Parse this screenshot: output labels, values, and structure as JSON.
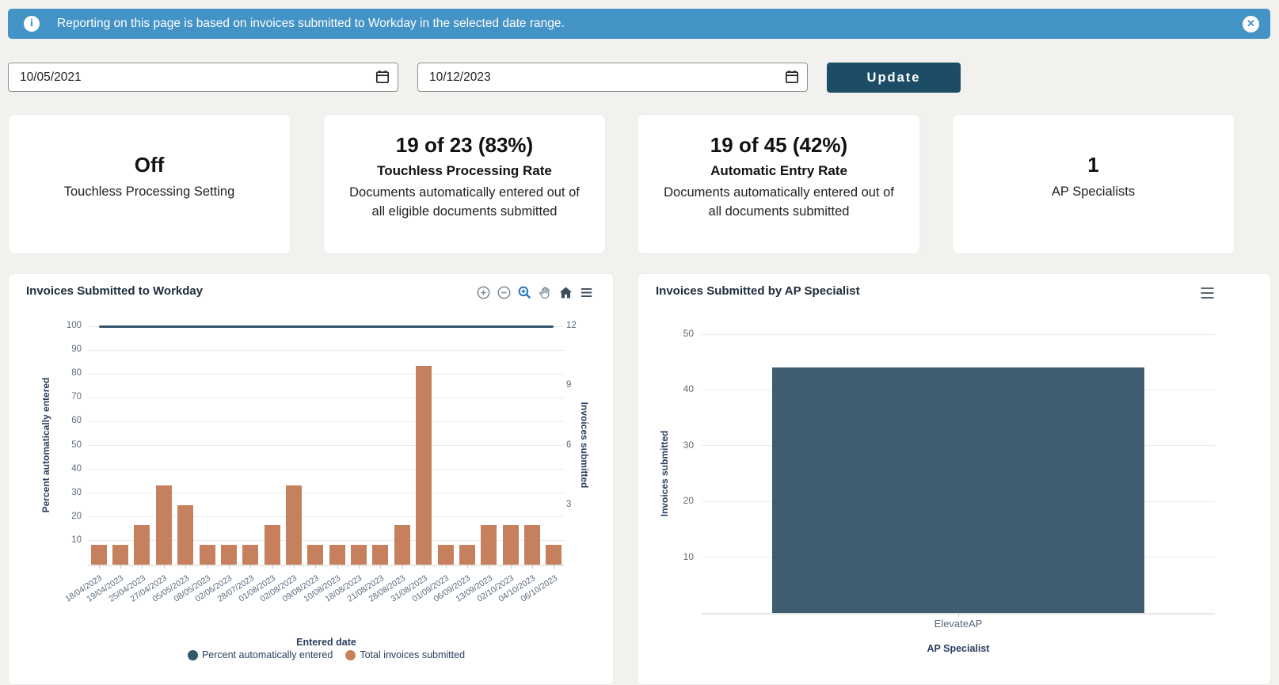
{
  "banner": {
    "message": "Reporting on this page is based on invoices submitted to Workday in the selected date range.",
    "info_icon": "i",
    "close_icon": "✕",
    "bg_color": "#4493c6"
  },
  "filters": {
    "start_date": "10/05/2021",
    "end_date": "10/12/2023",
    "update_label": "Update",
    "button_color": "#1d4c66",
    "date_icon": "calendar-icon"
  },
  "stat_cards": [
    {
      "value": "Off",
      "subtitle": "",
      "description": "Touchless Processing Setting"
    },
    {
      "value": "19 of 23 (83%)",
      "subtitle": "Touchless Processing Rate",
      "description": "Documents automatically entered out of all eligible documents submitted"
    },
    {
      "value": "19 of 45 (42%)",
      "subtitle": "Automatic Entry Rate",
      "description": "Documents automatically entered out of all documents submitted"
    },
    {
      "value": "1",
      "subtitle": "",
      "description": "AP Specialists"
    }
  ],
  "modebar": {
    "tools": [
      "zoom-in-icon",
      "zoom-out-icon",
      "zoom-area-icon",
      "pan-hand-icon",
      "home-icon",
      "menu-icon"
    ],
    "active_tool": "zoom-area-icon",
    "active_color": "#1d6fbe",
    "idle_color": "#7a8796",
    "dark_color": "#3c4d5d"
  },
  "chart_data": [
    {
      "type": "bar+line",
      "title": "Invoices Submitted to Workday",
      "x": [
        "18/04/2023",
        "19/04/2023",
        "25/04/2023",
        "27/04/2023",
        "05/05/2023",
        "08/05/2023",
        "02/06/2023",
        "28/07/2023",
        "01/08/2023",
        "02/08/2023",
        "09/08/2023",
        "10/08/2023",
        "18/08/2023",
        "21/08/2023",
        "28/08/2023",
        "31/08/2023",
        "01/09/2023",
        "06/09/2023",
        "13/09/2023",
        "02/10/2023",
        "04/10/2023",
        "06/10/2023"
      ],
      "xlabel": "Entered date",
      "series": [
        {
          "name": "Percent automatically entered",
          "type": "line",
          "yaxis": "left",
          "color": "#33566b",
          "values": [
            100,
            100,
            100,
            100,
            100,
            100,
            100,
            100,
            100,
            100,
            100,
            100,
            100,
            100,
            100,
            100,
            100,
            100,
            100,
            100,
            100,
            100
          ]
        },
        {
          "name": "Total invoices submitted",
          "type": "bar",
          "yaxis": "right",
          "color": "#c6805d",
          "values": [
            1,
            1,
            2,
            4,
            3,
            1,
            1,
            1,
            2,
            4,
            1,
            1,
            1,
            1,
            2,
            10,
            1,
            1,
            2,
            2,
            2,
            1
          ]
        }
      ],
      "yaxis_left": {
        "label": "Percent automatically entered",
        "range": [
          0,
          100
        ],
        "ticks": [
          10,
          20,
          30,
          40,
          50,
          60,
          70,
          80,
          90,
          100
        ]
      },
      "yaxis_right": {
        "label": "Invoices submitted",
        "range": [
          0,
          12
        ],
        "ticks": [
          3,
          6,
          9,
          12
        ]
      },
      "grid": true,
      "legend_position": "bottom"
    },
    {
      "type": "bar",
      "title": "Invoices Submitted by AP Specialist",
      "categories": [
        "ElevateAP"
      ],
      "values": [
        44
      ],
      "xlabel": "AP Specialist",
      "ylabel": "Invoices submitted",
      "ylim": [
        0,
        50
      ],
      "yticks": [
        10,
        20,
        30,
        40,
        50
      ],
      "bar_color": "#3f5c70",
      "grid": true
    }
  ]
}
